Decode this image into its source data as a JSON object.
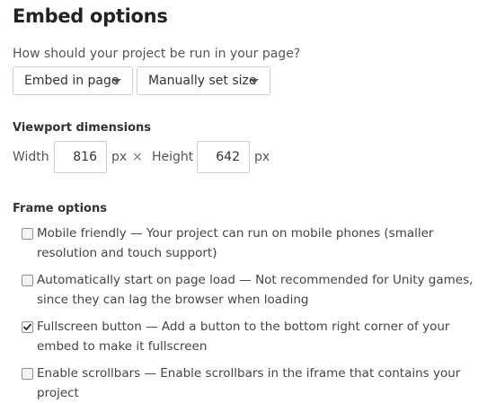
{
  "title": "Embed options",
  "question": "How should your project be run in your page?",
  "embed_select": {
    "value": "Embed in page"
  },
  "size_select": {
    "value": "Manually set size"
  },
  "viewport": {
    "label": "Viewport dimensions",
    "width_label": "Width",
    "width_value": "816",
    "width_unit": "px",
    "times": "×",
    "height_label": "Height",
    "height_value": "642",
    "height_unit": "px"
  },
  "frame_options": {
    "label": "Frame options",
    "items": [
      {
        "text": "Mobile friendly — Your project can run on mobile phones (smaller resolution and touch support)",
        "checked": false
      },
      {
        "text": "Automatically start on page load — Not recommended for Unity games, since they can lag the browser when loading",
        "checked": false
      },
      {
        "text": "Fullscreen button — Add a button to the bottom right corner of your embed to make it fullscreen",
        "checked": true
      },
      {
        "text": "Enable scrollbars — Enable scrollbars in the iframe that contains your project",
        "checked": false
      }
    ]
  }
}
